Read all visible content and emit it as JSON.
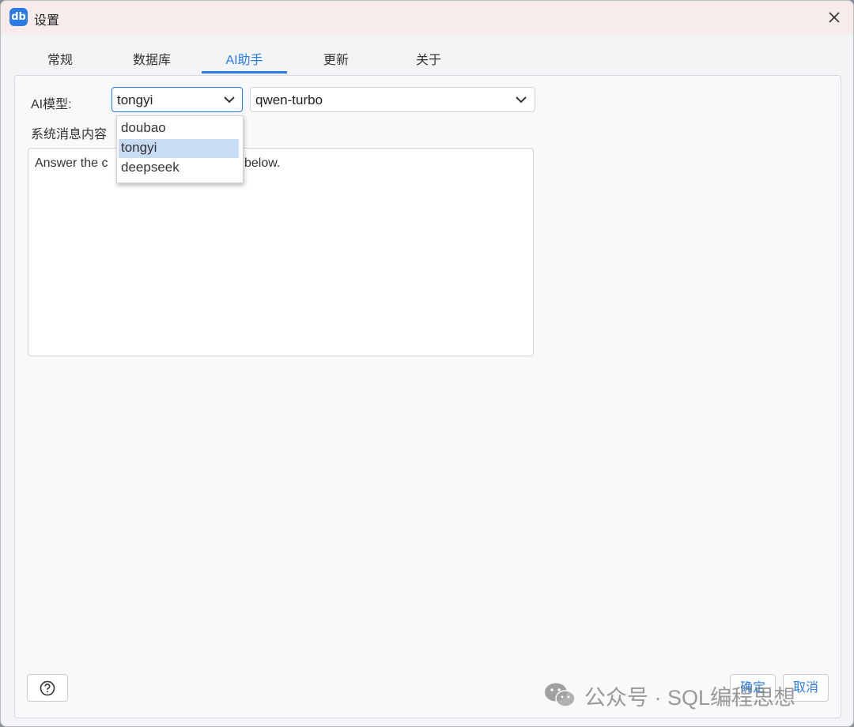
{
  "window": {
    "title": "设置",
    "app_icon_text": "db"
  },
  "tabs": [
    {
      "label": "常规",
      "active": false
    },
    {
      "label": "数据库",
      "active": false
    },
    {
      "label": "AI助手",
      "active": true
    },
    {
      "label": "更新",
      "active": false
    },
    {
      "label": "关于",
      "active": false
    }
  ],
  "form": {
    "model_label": "AI模型:",
    "provider_value": "tongyi",
    "model_value": "qwen-turbo",
    "system_message_label": "系统消息内容",
    "system_message_value": "Answer the c                         he table below."
  },
  "provider_dropdown": {
    "options": [
      "doubao",
      "tongyi",
      "deepseek"
    ],
    "selected": "tongyi"
  },
  "footer": {
    "confirm_label": "确定",
    "cancel_label": "取消"
  },
  "watermark": {
    "text": "公众号 · SQL编程思想"
  },
  "colors": {
    "accent": "#2a7be6",
    "selected_option_bg": "#c8dcf6",
    "titlebar_bg": "#f7eceb"
  },
  "icons": {
    "close": "close-icon",
    "help": "help-icon",
    "chevron": "chevron-down-icon",
    "wechat": "wechat-icon"
  }
}
